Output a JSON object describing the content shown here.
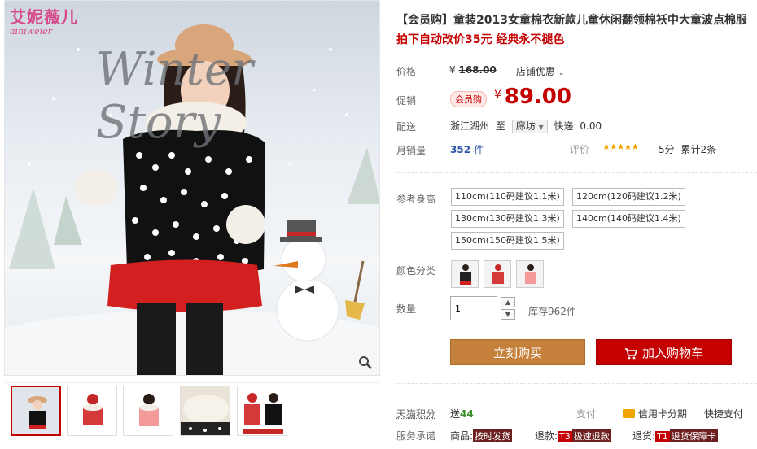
{
  "gallery": {
    "brand_cn": "艾妮薇儿",
    "brand_en": "ainiweier",
    "winter_text": "Winter Story",
    "zoom_icon": "magnifier-icon",
    "thumbs": [
      {
        "name": "thumb-polka-coat-front"
      },
      {
        "name": "thumb-red-coat"
      },
      {
        "name": "thumb-pink-coat"
      },
      {
        "name": "thumb-fur-collar-detail"
      },
      {
        "name": "thumb-red-black-coats"
      }
    ]
  },
  "product": {
    "title": "【会员购】童装2013女童棉衣新款儿童休闲翻领棉袄中大童波点棉服",
    "subtitle": "拍下自动改价35元 经典永不褪色"
  },
  "price": {
    "label": "价格",
    "currency": "¥",
    "original": "168.00",
    "store_promo": "店铺优惠",
    "promo_label": "促销",
    "promo_tag": "会员购",
    "current": "89.00"
  },
  "shipping": {
    "label": "配送",
    "from": "浙江湖州",
    "to_word": "至",
    "destination": "廊坊",
    "express": "快递: 0.00"
  },
  "sales": {
    "label": "月销量",
    "count": "352",
    "unit": "件",
    "rating_label": "评价",
    "stars": "★★★★★",
    "score": "5分",
    "total": "累计2条"
  },
  "sizes": {
    "label": "参考身高",
    "options": [
      "110cm(110码建议1.1米)",
      "120cm(120码建议1.2米)",
      "130cm(130码建议1.3米)",
      "140cm(140码建议1.4米)",
      "150cm(150码建议1.5米)"
    ]
  },
  "colors": {
    "label": "颜色分类",
    "swatches": [
      "black-polka",
      "red",
      "pink"
    ]
  },
  "quantity": {
    "label": "数量",
    "value": "1",
    "stock": "库存962件"
  },
  "actions": {
    "buy": "立刻购买",
    "cart": "加入购物车"
  },
  "footer": {
    "points_label": "天猫积分",
    "points_prefix": "送",
    "points_value": "44",
    "pay_label": "支付",
    "credit": "信用卡分期",
    "quickpay": "快捷支付",
    "promise_label": "服务承诺",
    "svc_goods_label": "商品:",
    "svc_goods_tag": "按时发货",
    "svc_return_label": "退款:",
    "svc_return_code": "T3",
    "svc_return_tag": "极速退款",
    "svc_refund_label": "退货:",
    "svc_refund_code": "T1",
    "svc_refund_tag": "退货保障卡"
  },
  "colors_theme": {
    "accent": "#c40000",
    "buy": "#c5813b",
    "brand": "#d64a8c"
  }
}
